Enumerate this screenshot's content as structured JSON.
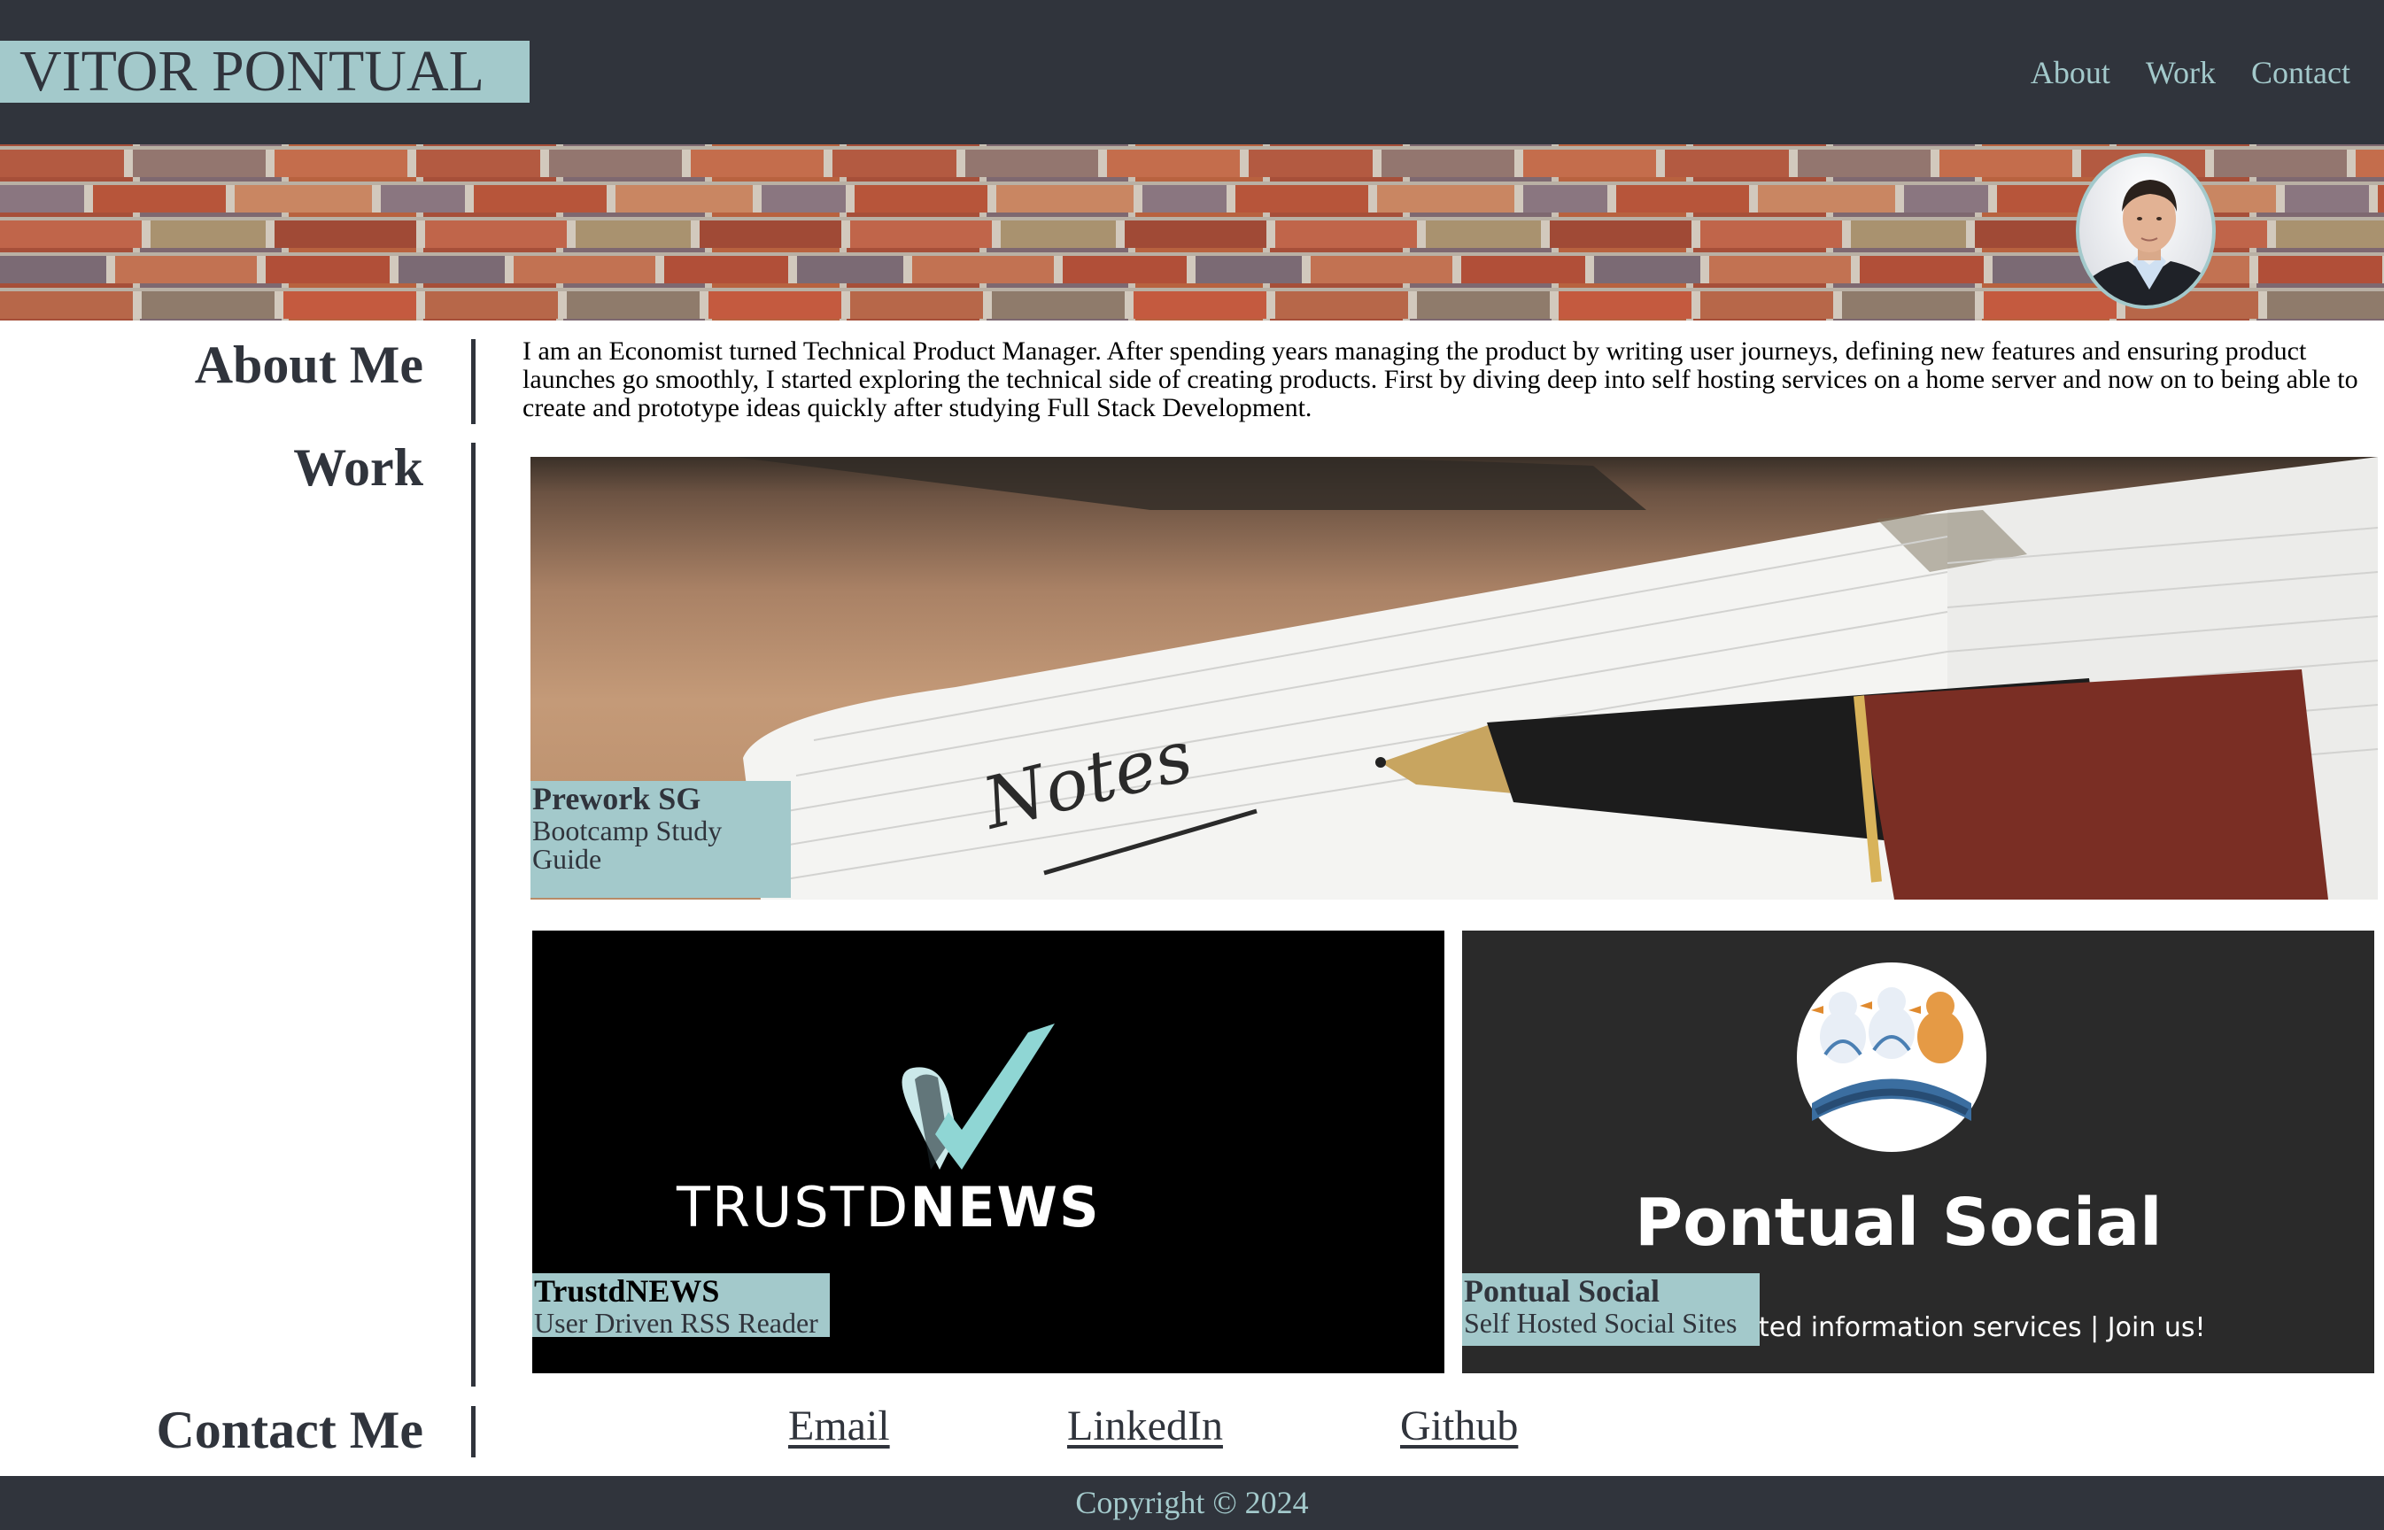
{
  "header": {
    "brand": "VITOR PONTUAL",
    "nav": [
      {
        "label": "About"
      },
      {
        "label": "Work"
      },
      {
        "label": "Contact"
      }
    ]
  },
  "about": {
    "heading": "About Me",
    "text": "I am an Economist turned Technical Product Manager. After spending years managing the product by writing user journeys, defining new features and ensuring product launches go smoothly, I started exploring the technical side of creating products. First by diving deep into self hosting services on a home server and now on to being able to create and prototype ideas quickly after studying Full Stack Development."
  },
  "work": {
    "heading": "Work",
    "projects": [
      {
        "title": "Prework SG",
        "subtitle": "Bootcamp Study Guide",
        "image_text": "Notes"
      },
      {
        "title": "TrustdNEWS",
        "subtitle": "User Driven RSS Reader",
        "logo_light": "TRUSTD",
        "logo_bold": "NEWS"
      },
      {
        "title": "Pontual Social",
        "subtitle": "Self Hosted Social Sites",
        "logo_title": "Pontual Social",
        "tagline_visible": "ted information services | Join us!"
      }
    ]
  },
  "contact": {
    "heading": "Contact Me",
    "links": [
      {
        "label": "Email"
      },
      {
        "label": "LinkedIn"
      },
      {
        "label": "Github"
      }
    ]
  },
  "footer": {
    "copyright": "Copyright © 2024"
  },
  "colors": {
    "dark": "#30343c",
    "accent": "#a3c9cb",
    "trustd_teal": "#8fd6d4"
  }
}
